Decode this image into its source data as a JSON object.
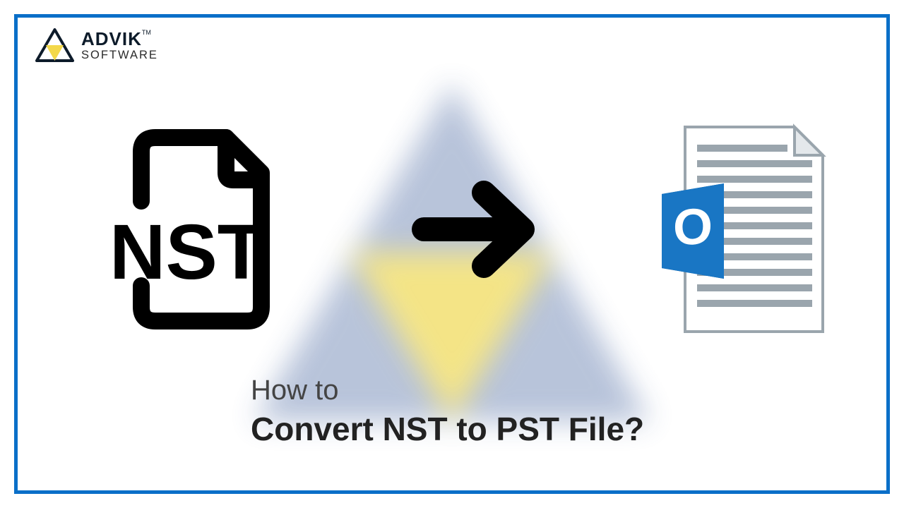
{
  "logo": {
    "brand_top": "ADVIK",
    "tm": "TM",
    "brand_bottom": "SOFTWARE"
  },
  "nst_label": "NST",
  "outlook_letter": "O",
  "caption": {
    "pre": "How to",
    "main": "Convert NST to PST File?"
  },
  "colors": {
    "border": "#0a6fc8",
    "outlook_blue": "#1976c4",
    "outlook_blue_dark": "#115a96",
    "watermark_blue": "#6f86b5",
    "watermark_yellow": "#f3e27a"
  }
}
